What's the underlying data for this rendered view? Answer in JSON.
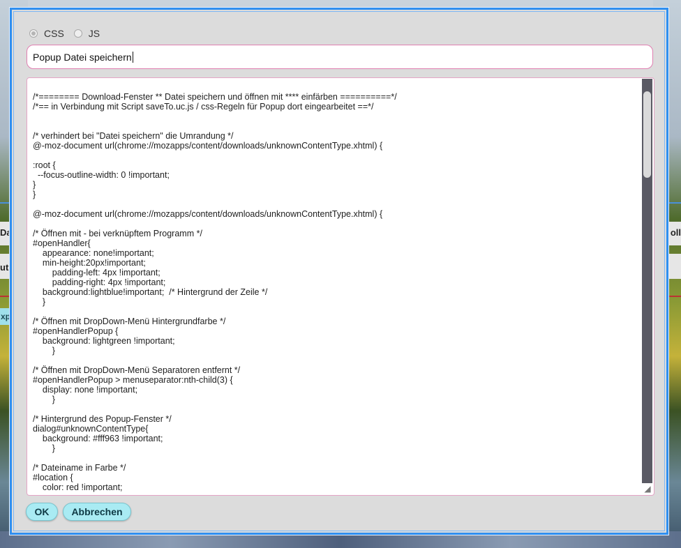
{
  "background": {
    "left_fragments": [
      "Da",
      "ut",
      "xp"
    ],
    "right_fragment": "oll"
  },
  "dialog": {
    "mode_options": [
      {
        "label": "CSS",
        "selected": true
      },
      {
        "label": "JS",
        "selected": false
      }
    ],
    "title_value": "Popup Datei speichern",
    "code_lines": [
      "/*======== Download-Fenster ** Datei speichern und öffnen mit **** einfärben ==========*/",
      "/*== in Verbindung mit Script saveTo.uc.js / css-Regeln für Popup dort eingearbeitet ==*/",
      "",
      "",
      "/* verhindert bei \"Datei speichern\" die Umrandung */",
      "@-moz-document url(chrome://mozapps/content/downloads/unknownContentType.xhtml) {",
      "",
      ":root {",
      "  --focus-outline-width: 0 !important;",
      "}",
      "}",
      "",
      "@-moz-document url(chrome://mozapps/content/downloads/unknownContentType.xhtml) {",
      "",
      "/* Öffnen mit - bei verknüpftem Programm */",
      "#openHandler{",
      "    appearance: none!important;",
      "    min-height:20px!important;",
      "        padding-left: 4px !important;",
      "        padding-right: 4px !important;",
      "    background:lightblue!important;  /* Hintergrund der Zeile */",
      "    }",
      "",
      "/* Öffnen mit DropDown-Menü Hintergrundfarbe */",
      "#openHandlerPopup {",
      "    background: lightgreen !important;",
      "        }",
      "",
      "/* Öffnen mit DropDown-Menü Separatoren entfernt */",
      "#openHandlerPopup > menuseparator:nth-child(3) {",
      "    display: none !important;",
      "        }",
      "",
      "/* Hintergrund des Popup-Fenster */",
      "dialog#unknownContentType{",
      "    background: #fff963 !important;",
      "        }",
      "",
      "/* Dateiname in Farbe */",
      "#location {",
      "    color: red !important;"
    ],
    "buttons": {
      "ok": "OK",
      "cancel": "Abbrechen"
    }
  },
  "colors": {
    "dialog_border": "#2f8ff0",
    "button_bg": "#a9ebf3",
    "input_border": "#e07fb1",
    "scrollbar": "#5a5a64"
  }
}
